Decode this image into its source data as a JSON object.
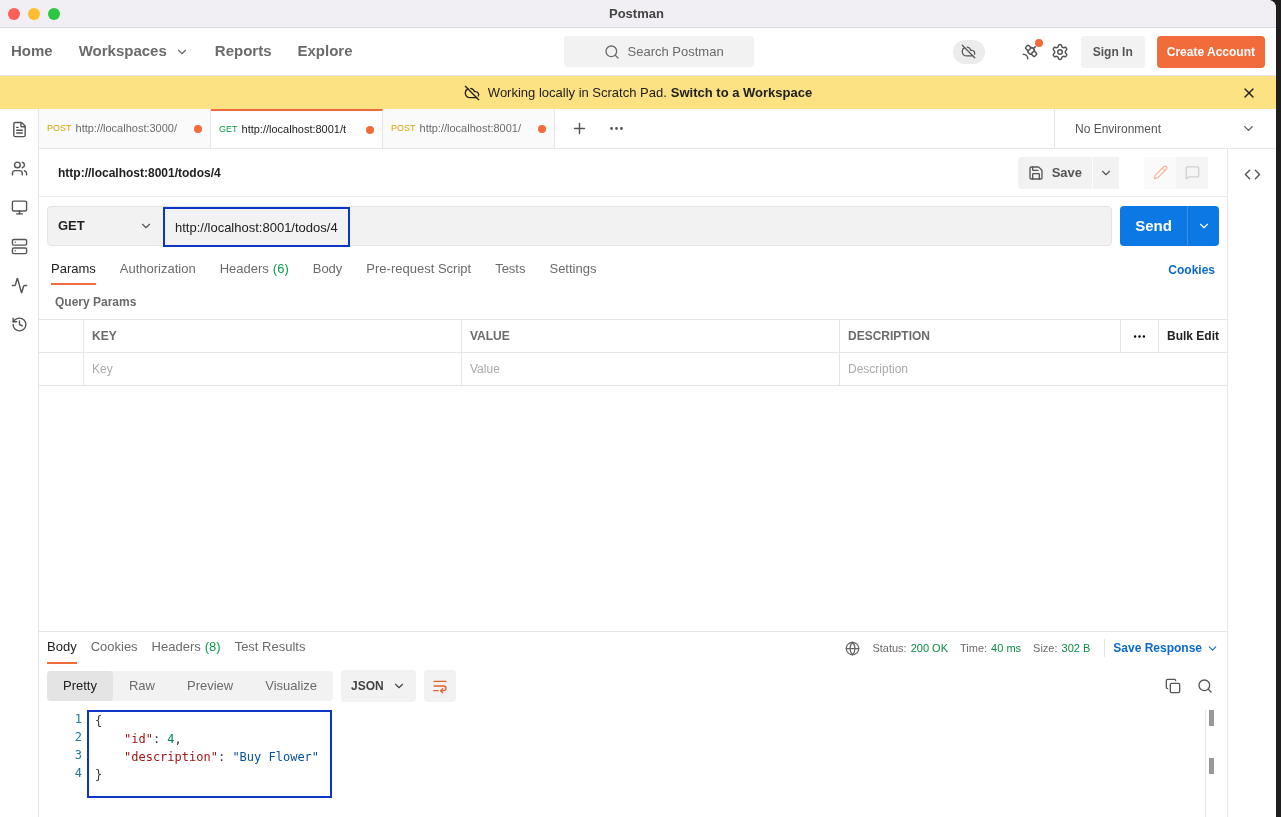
{
  "window": {
    "title": "Postman"
  },
  "nav": {
    "items": [
      {
        "label": "Home",
        "dropdown": false
      },
      {
        "label": "Workspaces",
        "dropdown": true
      },
      {
        "label": "Reports",
        "dropdown": false
      },
      {
        "label": "Explore",
        "dropdown": false
      }
    ],
    "search": {
      "placeholder": "Search Postman"
    },
    "sign_in": "Sign In",
    "create_account": "Create Account",
    "notification": true
  },
  "banner": {
    "text": "Working locally in Scratch Pad.",
    "link": "Switch to a Workspace"
  },
  "request_tabs": [
    {
      "method": "POST",
      "kind": "post",
      "url": "http://localhost:3000/",
      "selected": false,
      "unsaved": true
    },
    {
      "method": "GET",
      "kind": "get",
      "url": "http://localhost:8001/t",
      "selected": true,
      "unsaved": true
    },
    {
      "method": "POST",
      "kind": "post",
      "url": "http://localhost:8001/",
      "selected": false,
      "unsaved": true
    }
  ],
  "environment": "No Environment",
  "request": {
    "title": "http://localhost:8001/todos/4",
    "save": "Save",
    "method": "GET",
    "url": "http://localhost:8001/todos/4",
    "send": "Send"
  },
  "request_sections": [
    {
      "label": "Params",
      "selected": true
    },
    {
      "label": "Authorization",
      "selected": false
    },
    {
      "label": "Headers",
      "count": "(6)",
      "selected": false
    },
    {
      "label": "Body",
      "selected": false
    },
    {
      "label": "Pre-request Script",
      "selected": false
    },
    {
      "label": "Tests",
      "selected": false
    },
    {
      "label": "Settings",
      "selected": false
    }
  ],
  "cookies": "Cookies",
  "query_params": {
    "title": "Query Params",
    "columns": [
      "KEY",
      "VALUE",
      "DESCRIPTION"
    ],
    "bulk_edit": "Bulk Edit",
    "placeholders": [
      "Key",
      "Value",
      "Description"
    ]
  },
  "response": {
    "tabs": [
      {
        "label": "Body",
        "selected": true
      },
      {
        "label": "Cookies",
        "selected": false
      },
      {
        "label": "Headers",
        "count": "(8)",
        "selected": false
      },
      {
        "label": "Test Results",
        "selected": false
      }
    ],
    "status": [
      {
        "label": "Status:",
        "value": "200 OK"
      },
      {
        "label": "Time:",
        "value": "40 ms"
      },
      {
        "label": "Size:",
        "value": "302 B"
      }
    ],
    "save_response": "Save Response",
    "views": [
      {
        "label": "Pretty",
        "selected": true
      },
      {
        "label": "Raw",
        "selected": false
      },
      {
        "label": "Preview",
        "selected": false
      },
      {
        "label": "Visualize",
        "selected": false
      }
    ],
    "format": "JSON",
    "code": [
      {
        "number": "1",
        "indented": false,
        "tokens": [
          {
            "kind": "punct",
            "text": "{"
          }
        ]
      },
      {
        "number": "2",
        "indented": true,
        "tokens": [
          {
            "kind": "key",
            "text": "\"id\""
          },
          {
            "kind": "punct",
            "text": ": "
          },
          {
            "kind": "number",
            "text": "4"
          },
          {
            "kind": "punct",
            "text": ","
          }
        ]
      },
      {
        "number": "3",
        "indented": true,
        "tokens": [
          {
            "kind": "key",
            "text": "\"description\""
          },
          {
            "kind": "punct",
            "text": ": "
          },
          {
            "kind": "string",
            "text": "\"Buy Flower\""
          }
        ]
      },
      {
        "number": "4",
        "indented": false,
        "tokens": [
          {
            "kind": "punct",
            "text": "}"
          }
        ]
      }
    ]
  }
}
